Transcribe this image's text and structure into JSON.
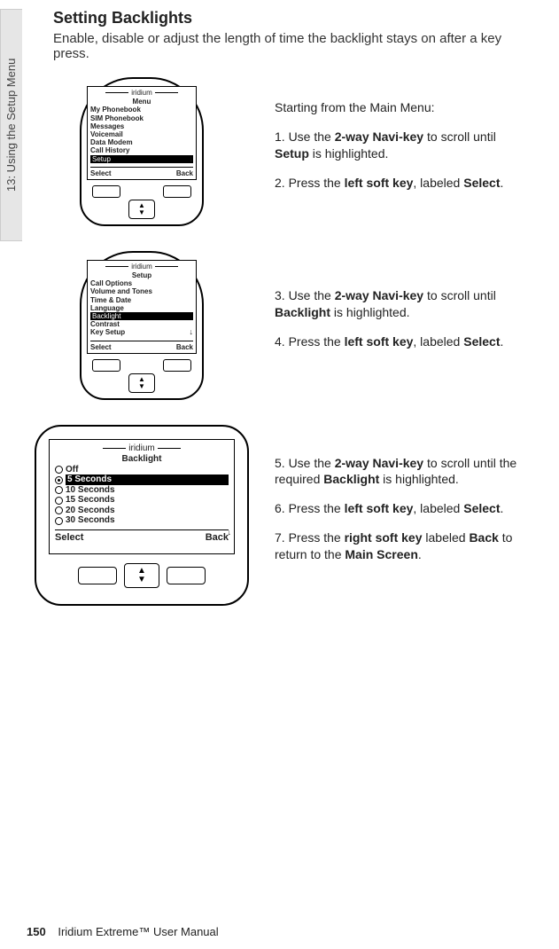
{
  "side_tab": "13: Using the Setup Menu",
  "title": "Setting Backlights",
  "intro": "Enable, disable or adjust the length of time the backlight stays on after a key press.",
  "starting": "Starting from the Main Menu:",
  "steps": {
    "s1a": "1. Use the ",
    "s1b": "2-way Navi-key",
    "s1c": " to scroll until ",
    "s1d": "Setup",
    "s1e": " is highlighted.",
    "s2a": "2. Press the ",
    "s2b": "left soft key",
    "s2c": ", labeled ",
    "s2d": "Select",
    "s2e": ".",
    "s3a": "3. Use the ",
    "s3b": "2-way Navi-key",
    "s3c": " to scroll until ",
    "s3d": "Backlight",
    "s3e": " is highlighted.",
    "s4a": "4. Press the ",
    "s4b": "left soft key",
    "s4c": ", labeled ",
    "s4d": "Select",
    "s4e": ".",
    "s5a": "5. Use the ",
    "s5b": "2-way Navi-key",
    "s5c": " to scroll until the required ",
    "s5d": "Backlight",
    "s5e": " is highlighted.",
    "s6a": "6. Press the ",
    "s6b": "left soft key",
    "s6c": ", labeled ",
    "s6d": "Select",
    "s6e": ".",
    "s7a": "7. Press the ",
    "s7b": "right soft key",
    "s7c": " labeled ",
    "s7d": "Back",
    "s7e": " to return to the ",
    "s7f": "Main Screen",
    "s7g": "."
  },
  "phone1": {
    "brand": "iridium",
    "screen_title": "Menu",
    "items": [
      "My Phonebook",
      "SIM Phonebook",
      "Messages",
      "Voicemail",
      "Data Modem",
      "Call History"
    ],
    "hl": "Setup",
    "left": "Select",
    "right": "Back"
  },
  "phone2": {
    "brand": "iridium",
    "screen_title": "Setup",
    "items_top": [
      "Call Options",
      "Volume and Tones",
      "Time & Date",
      "Language"
    ],
    "hl": "Backlight",
    "items_bottom": [
      "Contrast",
      "Key Setup"
    ],
    "left": "Select",
    "right": "Back"
  },
  "phone3": {
    "brand": "iridium",
    "screen_title": "Backlight",
    "items": [
      "Off",
      "5 Seconds",
      "10 Seconds",
      "15 Seconds",
      "20 Seconds",
      "30 Seconds"
    ],
    "selected_index": 1,
    "left": "Select",
    "right": "Back"
  },
  "footer": {
    "page": "150",
    "book": "Iridium Extreme™ User Manual"
  }
}
